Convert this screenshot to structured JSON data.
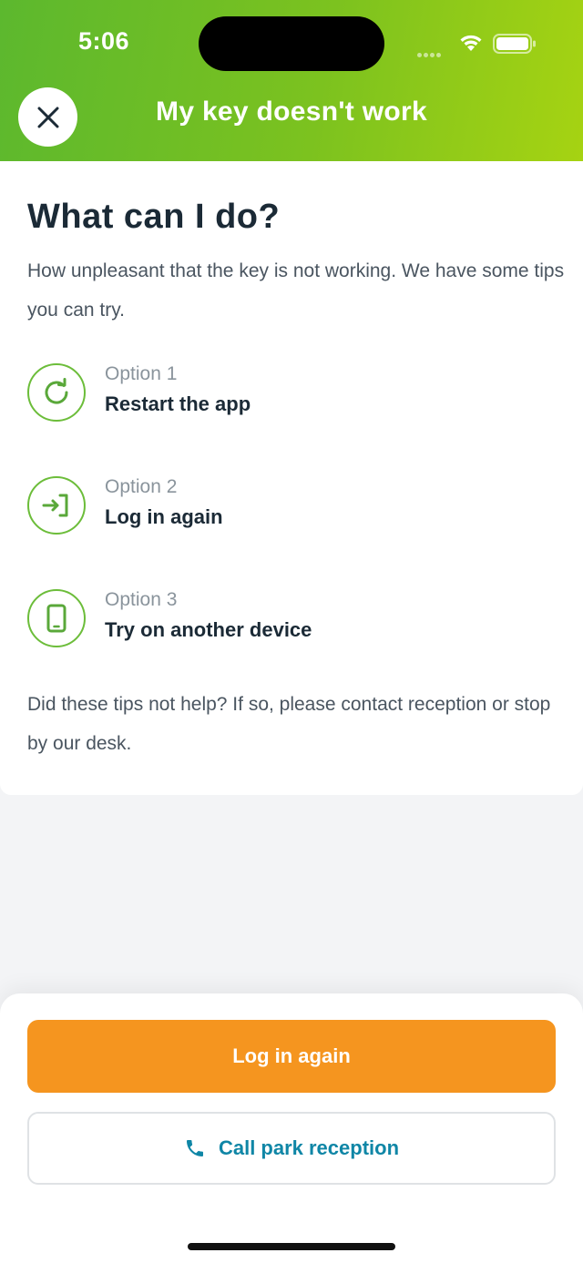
{
  "status_bar": {
    "time": "5:06"
  },
  "header": {
    "title": "My key doesn't work",
    "close_icon": "close-icon"
  },
  "main": {
    "title": "What can I do?",
    "intro": "How unpleasant that the key is not working. We have some tips you can try.",
    "options": [
      {
        "label": "Option 1",
        "title": "Restart the app",
        "icon": "restart-icon"
      },
      {
        "label": "Option 2",
        "title": "Log in again",
        "icon": "login-icon"
      },
      {
        "label": "Option 3",
        "title": "Try on another device",
        "icon": "phone-icon"
      }
    ],
    "outro": "Did these tips not help? If so, please contact reception or stop by our desk."
  },
  "actions": {
    "primary_label": "Log in again",
    "secondary_label": "Call park reception",
    "secondary_icon": "phone-call-icon"
  },
  "colors": {
    "header_gradient_start": "#5cb82e",
    "header_gradient_end": "#a6d312",
    "accent_green": "#6cbd3a",
    "primary_orange": "#f5951f",
    "link_teal": "#0f86a6"
  }
}
